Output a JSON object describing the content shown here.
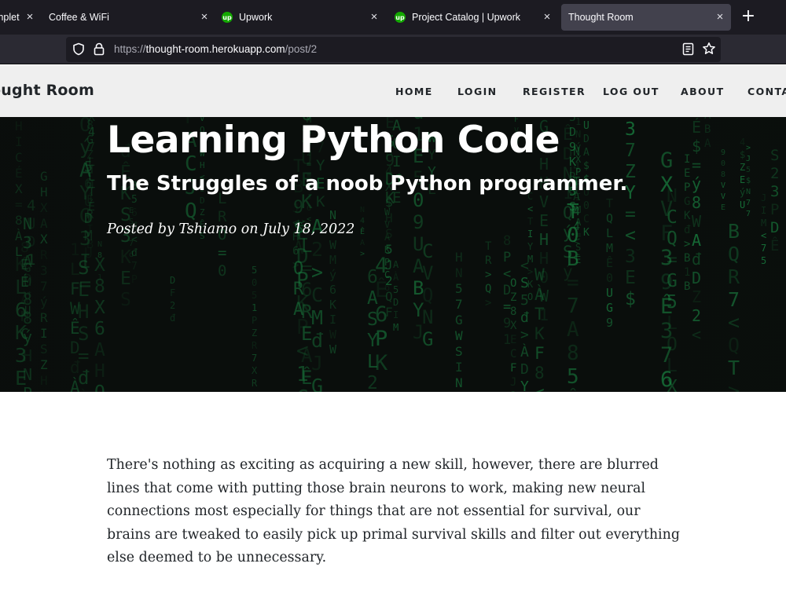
{
  "browser": {
    "tabs": [
      {
        "title": "mplet",
        "favicon": "",
        "active": false
      },
      {
        "title": "Coffee & WiFi",
        "favicon": "",
        "active": false
      },
      {
        "title": "Upwork",
        "favicon": "up",
        "active": false
      },
      {
        "title": "Project Catalog | Upwork",
        "favicon": "up",
        "active": false
      },
      {
        "title": "Thought Room",
        "favicon": "",
        "active": true
      }
    ],
    "url": {
      "scheme": "https://",
      "host": "thought-room.herokuapp.com",
      "path": "/post/2"
    },
    "icons": [
      "shield-icon",
      "lock-icon",
      "reader-view-icon",
      "bookmark-star-icon",
      "close-icon",
      "new-tab-icon"
    ]
  },
  "site": {
    "brand": "ought Room",
    "nav": [
      "HOME",
      "LOGIN",
      "REGISTER",
      "LOG OUT",
      "ABOUT",
      "CONTA"
    ]
  },
  "post": {
    "title": "Learning Python Code",
    "subtitle": "The Struggles of a noob Python programmer.",
    "meta": "Posted by Tshiamo on July 18, 2022",
    "body": "There's nothing as exciting as acquiring a new skill, however, there are blurred lines that come with putting those brain neurons to work, making new neural connections most especially for things that are not essential for survival, our brains are tweaked to easily pick up primal survival skills and filter out everything else deemed to be unnecessary."
  },
  "colors": {
    "tab_strip": "#1c1b22",
    "tab_active": "#42414d",
    "url_bar": "#1c1b22",
    "site_nav": "#efefef",
    "matrix_green": "#1fae55",
    "upwork_green": "#14a800"
  }
}
